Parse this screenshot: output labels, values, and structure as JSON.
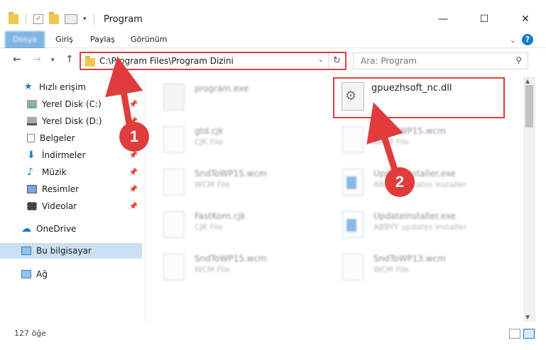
{
  "window": {
    "title": "Program",
    "minimize": "—",
    "maximize": "☐",
    "close": "✕"
  },
  "ribbon": {
    "tabs": [
      "Dosya",
      "Giriş",
      "Paylaş",
      "Görünüm"
    ],
    "help": "?"
  },
  "address": {
    "path": "C:\\Program Files\\Program Dizini"
  },
  "search": {
    "placeholder": "Ara: Program"
  },
  "sidebar": {
    "items": [
      {
        "label": "Hızlı erişim",
        "icon": "star-icon"
      },
      {
        "label": "Yerel Disk (C:)",
        "icon": "drive-icon"
      },
      {
        "label": "Yerel Disk (D:)",
        "icon": "drive-icon"
      },
      {
        "label": "Belgeler",
        "icon": "documents-icon"
      },
      {
        "label": "İndirmeler",
        "icon": "download-icon"
      },
      {
        "label": "Müzik",
        "icon": "music-icon"
      },
      {
        "label": "Resimler",
        "icon": "pictures-icon"
      },
      {
        "label": "Videolar",
        "icon": "videos-icon"
      },
      {
        "label": "OneDrive",
        "icon": "cloud-icon"
      },
      {
        "label": "Bu bilgisayar",
        "icon": "computer-icon"
      },
      {
        "label": "Ağ",
        "icon": "network-icon"
      }
    ]
  },
  "files": [
    {
      "name": "program.exe",
      "type": ""
    },
    {
      "name": "gpuezhsoft_nc.dll",
      "type": ""
    },
    {
      "name": "gtd.cjk",
      "type": "CJK File"
    },
    {
      "name": "SndToWP15.wcm",
      "type": "WCM File"
    },
    {
      "name": "SndToWP15.wcm",
      "type": "WCM File"
    },
    {
      "name": "UpdateInstaller.exe",
      "type": "ABBYY updates installer"
    },
    {
      "name": "FastKorn.cjk",
      "type": "CJK File"
    },
    {
      "name": "UpdateInstaller.exe",
      "type": "ABBYY updates installer"
    },
    {
      "name": "SndToWP15.wcm",
      "type": "WCM File"
    },
    {
      "name": "SndToWP13.wcm",
      "type": "WCM File"
    }
  ],
  "status": {
    "count": "127 öğe"
  },
  "callouts": {
    "one": "1",
    "two": "2"
  },
  "colors": {
    "accent": "#1979ca",
    "highlight": "#e03c3c",
    "selected": "#cce0f3"
  }
}
